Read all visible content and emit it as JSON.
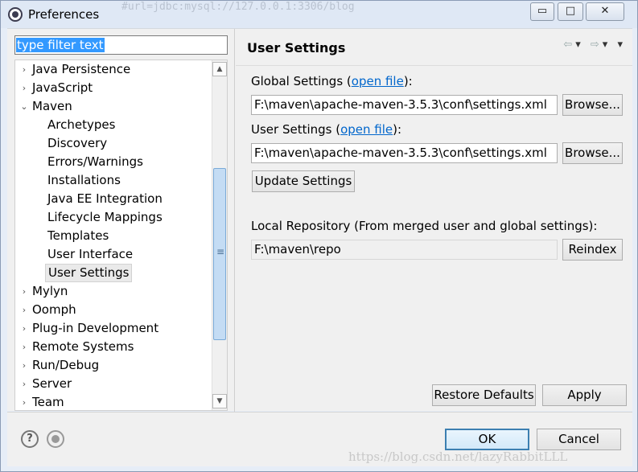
{
  "window": {
    "title": "Preferences",
    "background_code_lines": [
      "#url=jdbc:mysql://127.0.0.1:3306/blog"
    ],
    "minimize_glyph": "▭",
    "maximize_glyph": "□",
    "close_glyph": "✕"
  },
  "sidebar": {
    "filter_text": "type filter text",
    "items": [
      {
        "label": "Java Persistence",
        "chevron": "›"
      },
      {
        "label": "JavaScript",
        "chevron": "›"
      },
      {
        "label": "Maven",
        "chevron": "⌄"
      },
      {
        "label": "Archetypes"
      },
      {
        "label": "Discovery"
      },
      {
        "label": "Errors/Warnings"
      },
      {
        "label": "Installations"
      },
      {
        "label": "Java EE Integration"
      },
      {
        "label": "Lifecycle Mappings"
      },
      {
        "label": "Templates"
      },
      {
        "label": "User Interface"
      },
      {
        "label": "User Settings"
      },
      {
        "label": "Mylyn",
        "chevron": "›"
      },
      {
        "label": "Oomph",
        "chevron": "›"
      },
      {
        "label": "Plug-in Development",
        "chevron": "›"
      },
      {
        "label": "Remote Systems",
        "chevron": "›"
      },
      {
        "label": "Run/Debug",
        "chevron": "›"
      },
      {
        "label": "Server",
        "chevron": "›"
      },
      {
        "label": "Team",
        "chevron": "›"
      }
    ],
    "selected_item": "User Settings"
  },
  "page": {
    "title": "User Settings",
    "nav_icons": [
      "back-arrow-icon",
      "dropdown-icon",
      "forward-arrow-icon",
      "dropdown-icon",
      "view-menu-icon"
    ],
    "global_settings_label": "Global Settings (",
    "global_settings_link": "open file",
    "global_settings_suffix": "):",
    "global_settings_path": "F:\\maven\\apache-maven-3.5.3\\conf\\settings.xml",
    "user_settings_label": "User Settings (",
    "user_settings_link": "open file",
    "user_settings_suffix": "):",
    "user_settings_path": "F:\\maven\\apache-maven-3.5.3\\conf\\settings.xml",
    "browse_label": "Browse...",
    "update_settings_label": "Update Settings",
    "local_repo_label": "Local Repository (From merged user and global settings):",
    "local_repo_path": "F:\\maven\\repo",
    "reindex_label": "Reindex",
    "restore_defaults_label": "Restore Defaults",
    "apply_label": "Apply"
  },
  "footer": {
    "help_icon": "help-icon",
    "help_glyph": "?",
    "record_icon": "record-icon",
    "ok_label": "OK",
    "cancel_label": "Cancel",
    "watermark": "https://blog.csdn.net/lazyRabbitLLL"
  }
}
